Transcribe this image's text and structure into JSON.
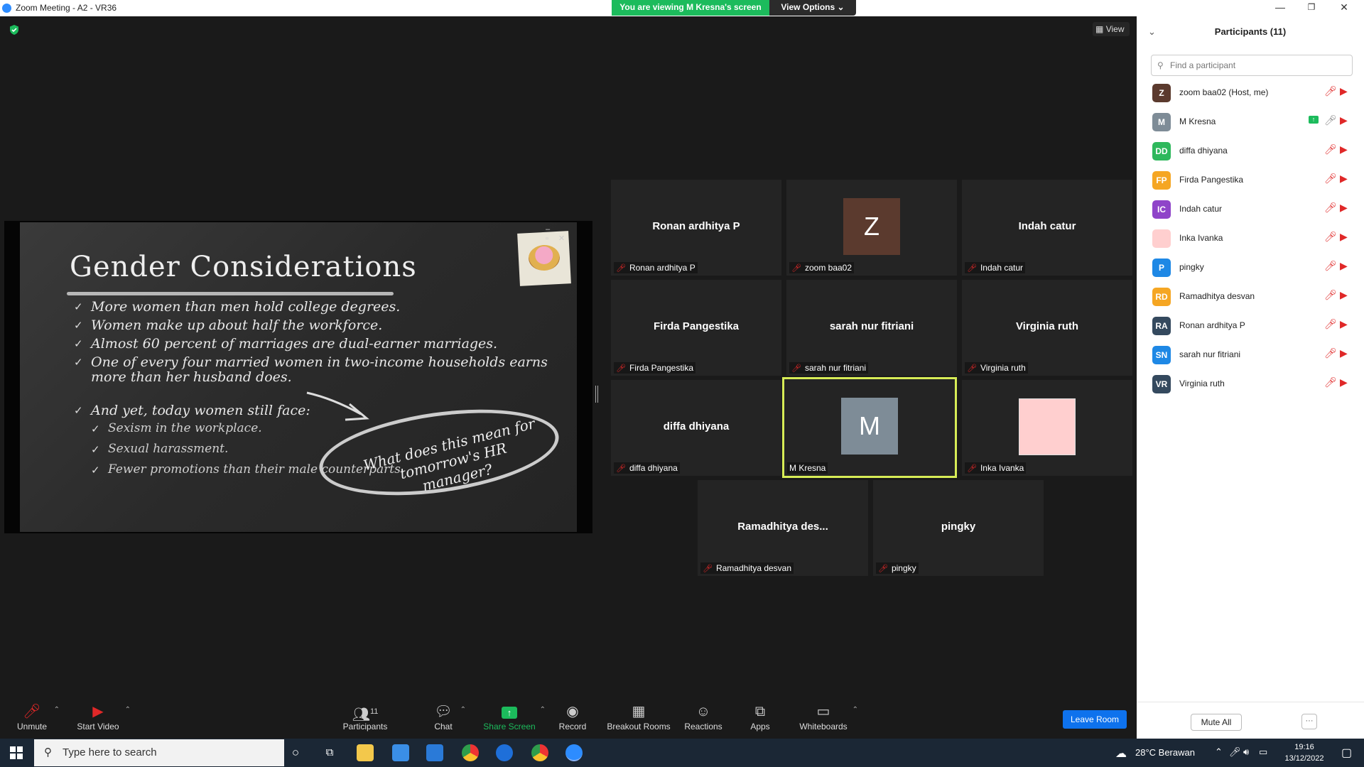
{
  "window": {
    "title": "Zoom Meeting - A2 - VR36",
    "viewing_banner": "You are viewing M Kresna's screen",
    "view_options": "View Options"
  },
  "meeting": {
    "view_label": "View"
  },
  "slide": {
    "title": "Gender Considerations",
    "bullets": [
      "More women than men hold college degrees.",
      "Women make up about half the workforce.",
      "Almost 60 percent of marriages are dual-earner marriages.",
      "One of every four married women in two-income households earns",
      "more than her husband does.",
      "And yet, today women still face:"
    ],
    "sub_bullets": [
      "Sexism in the workplace.",
      "Sexual harassment.",
      "Fewer promotions than their male counterparts."
    ],
    "bubble_line1": "What does this mean for",
    "bubble_line2": "tomorrow's HR manager?"
  },
  "tiles": [
    {
      "display": "Ronan ardhitya P",
      "name": "Ronan ardhitya P"
    },
    {
      "display": "Z",
      "name": "zoom baa02",
      "avatar_color": "#5b3a2e"
    },
    {
      "display": "Indah catur",
      "name": "Indah catur"
    },
    {
      "display": "Firda Pangestika",
      "name": "Firda Pangestika"
    },
    {
      "display": "sarah nur fitriani",
      "name": "sarah nur fitriani"
    },
    {
      "display": "Virginia ruth",
      "name": "Virginia ruth"
    },
    {
      "display": "diffa dhiyana",
      "name": "diffa dhiyana"
    },
    {
      "display": "M",
      "name": "M Kresna",
      "avatar_color": "#7e8c97"
    },
    {
      "display": "",
      "name": "Inka Ivanka",
      "avatar_color": "#ffcfcf"
    },
    {
      "display": "Ramadhitya des...",
      "name": "Ramadhitya desvan"
    },
    {
      "display": "pingky",
      "name": "pingky"
    }
  ],
  "toolbar": {
    "unmute": "Unmute",
    "start_video": "Start Video",
    "participants": "Participants",
    "participants_count": "11",
    "chat": "Chat",
    "share_screen": "Share Screen",
    "record": "Record",
    "breakout_rooms": "Breakout Rooms",
    "reactions": "Reactions",
    "apps": "Apps",
    "whiteboards": "Whiteboards",
    "leave_room": "Leave Room"
  },
  "panel": {
    "title": "Participants (11)",
    "search_placeholder": "Find a participant",
    "mute_all": "Mute All",
    "more": "···",
    "participants": [
      {
        "initials": "Z",
        "name": "zoom baa02 (Host, me)",
        "color": "#5b3a2e"
      },
      {
        "initials": "M",
        "name": "M Kresna",
        "color": "#7e8c97"
      },
      {
        "initials": "DD",
        "name": "diffa dhiyana",
        "color": "#2eb85c"
      },
      {
        "initials": "FP",
        "name": "Firda Pangestika",
        "color": "#f5a623"
      },
      {
        "initials": "IC",
        "name": "Indah catur",
        "color": "#8f44c9"
      },
      {
        "initials": "",
        "name": "Inka Ivanka",
        "color": "#ffcfcf"
      },
      {
        "initials": "P",
        "name": "pingky",
        "color": "#1e88e5"
      },
      {
        "initials": "RD",
        "name": "Ramadhitya desvan",
        "color": "#f5a623"
      },
      {
        "initials": "RA",
        "name": "Ronan ardhitya P",
        "color": "#34495e"
      },
      {
        "initials": "SN",
        "name": "sarah nur fitriani",
        "color": "#1e88e5"
      },
      {
        "initials": "VR",
        "name": "Virginia ruth",
        "color": "#34495e"
      }
    ]
  },
  "taskbar": {
    "search_placeholder": "Type here to search",
    "weather": "28°C Berawan",
    "time": "19:16",
    "date": "13/12/2022"
  }
}
